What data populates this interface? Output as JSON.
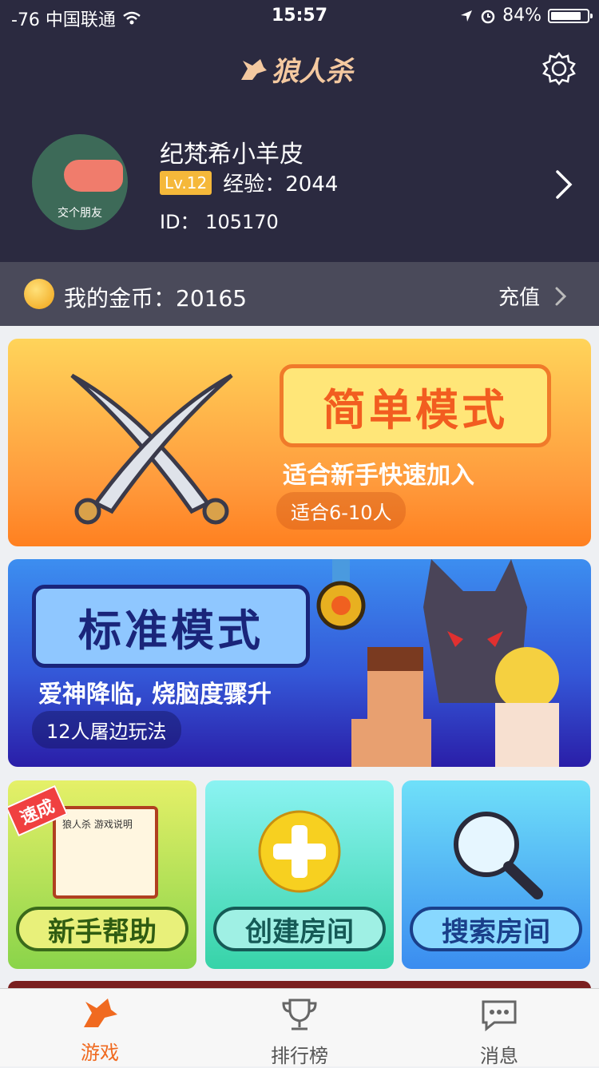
{
  "status_bar": {
    "carrier": "-76 中国联通",
    "time": "15:57",
    "battery": "84%",
    "battery_level": 0.84
  },
  "header": {
    "app_title": "狼人杀"
  },
  "profile": {
    "avatar_text": "交个朋友",
    "name": "纪梵希小羊皮",
    "level": "Lv.12",
    "exp": "经验：2044",
    "id": "ID： 105170"
  },
  "coins": {
    "label": "我的金币：20165",
    "recharge": "充值"
  },
  "modes": {
    "easy": {
      "title": "简单模式",
      "subtitle": "适合新手快速加入",
      "players": "适合6-10人"
    },
    "standard": {
      "title": "标准模式",
      "subtitle": "爱神降临, 烧脑度骤升",
      "players": "12人屠边玩法"
    }
  },
  "tiles": {
    "help": {
      "badge": "速成",
      "book_title": "狼人杀 游戏说明",
      "label": "新手帮助"
    },
    "create": {
      "label": "创建房间"
    },
    "search": {
      "label": "搜索房间"
    }
  },
  "tabbar": {
    "tabs": [
      {
        "label": "游戏"
      },
      {
        "label": "排行榜"
      },
      {
        "label": "消息"
      }
    ]
  },
  "colors": {
    "header_bg": "#2b2a40",
    "accent": "#f06a20",
    "coin_bar": "#4a4a5a"
  }
}
